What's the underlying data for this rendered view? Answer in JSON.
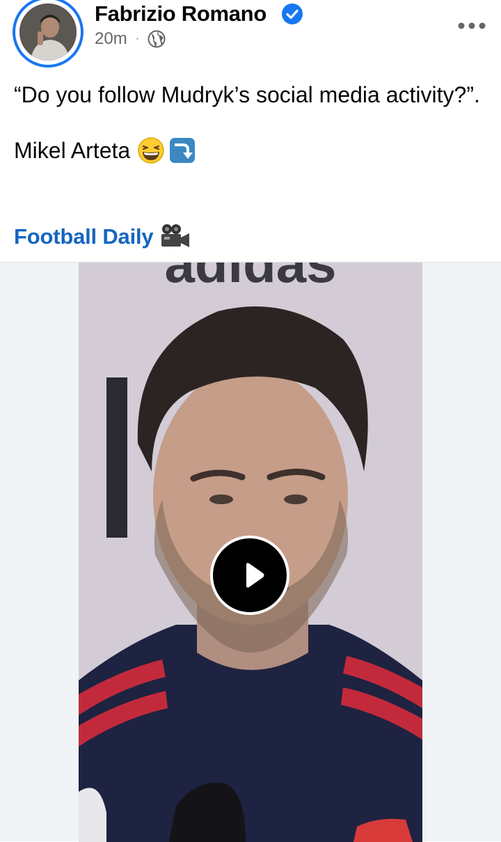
{
  "post": {
    "author": "Fabrizio Romano",
    "timestamp": "20m",
    "separator": "·",
    "audience_icon": "globe-icon",
    "verified_icon": "verified-badge-icon",
    "more_icon": "more-options-icon",
    "text_line1": "“Do you follow Mudryk’s social media activity?”.",
    "text_line2": "Mikel Arteta",
    "emojis": [
      "grinning-squinting-face",
      "arrow-curving-down"
    ],
    "page_link": "Football Daily",
    "page_link_icon": "movie-camera-icon"
  },
  "video": {
    "backdrop_text": "adidas",
    "play_icon": "play-icon"
  },
  "colors": {
    "link_blue": "#1565c0",
    "verified_blue": "#1877f2",
    "meta_gray": "#65676b"
  }
}
